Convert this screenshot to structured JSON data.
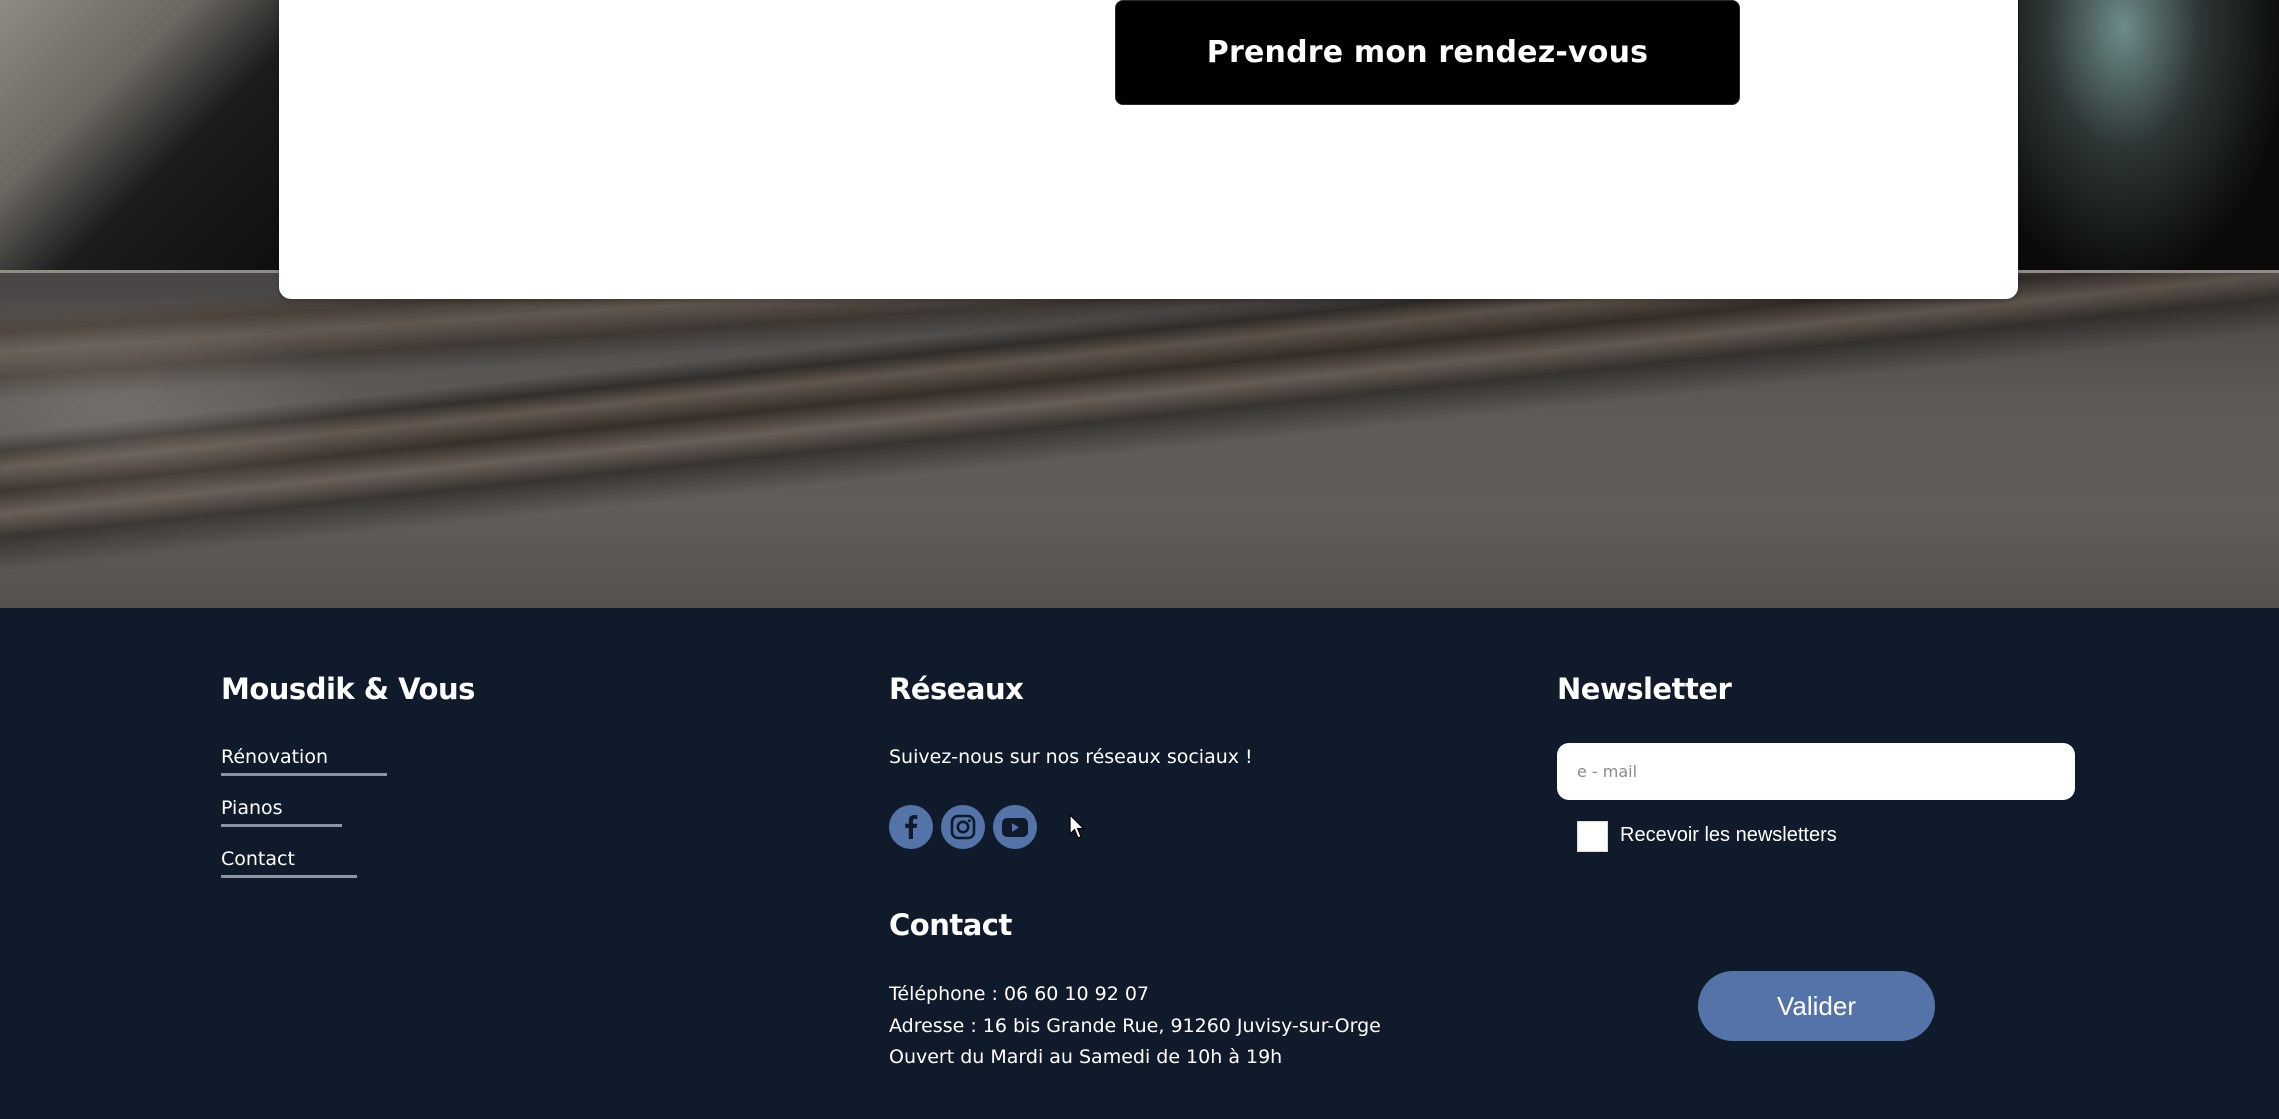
{
  "card": {
    "cta_label": "Prendre mon rendez-vous"
  },
  "footer": {
    "brand": {
      "title": "Mousdik & Vous",
      "links": [
        {
          "label": "Rénovation"
        },
        {
          "label": "Pianos"
        },
        {
          "label": "Contact"
        }
      ]
    },
    "social": {
      "title": "Réseaux",
      "subtitle": "Suivez-nous sur nos réseaux sociaux !",
      "icons": [
        "facebook-icon",
        "instagram-icon",
        "youtube-icon"
      ]
    },
    "contact": {
      "title": "Contact",
      "phone": "Téléphone : 06 60 10 92 07",
      "address": "Adresse : 16 bis Grande Rue, 91260 Juvisy-sur-Orge",
      "hours": "Ouvert du Mardi au Samedi de 10h à 19h"
    },
    "newsletter": {
      "title": "Newsletter",
      "email_placeholder": "e - mail",
      "checkbox_label": "Recevoir les newsletters",
      "submit_label": "Valider"
    }
  },
  "colors": {
    "footer_bg": "#0f1a2a",
    "accent": "#5473a8",
    "cta_bg": "#000000",
    "card_bg": "#ffffff"
  }
}
